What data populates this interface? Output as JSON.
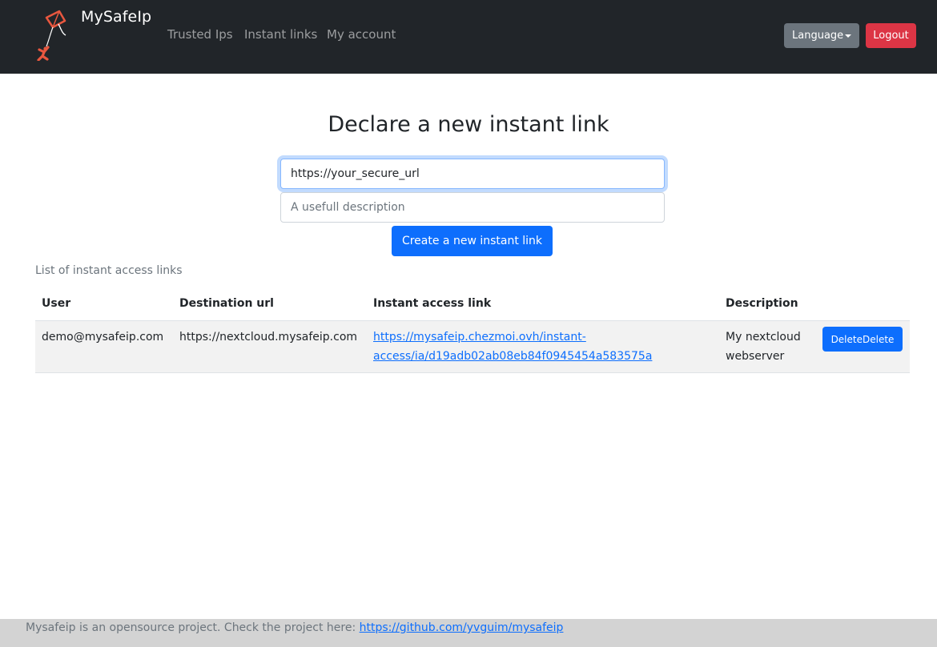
{
  "navbar": {
    "brand": "MySafeIp",
    "logo_icon": "kite-person-icon",
    "links": [
      "Trusted Ips",
      "Instant links",
      "My account"
    ],
    "language_label": "Language",
    "logout_label": "Logout"
  },
  "form": {
    "heading": "Declare a new instant link",
    "url_value": "https://your_secure_url",
    "description_placeholder": "A usefull description",
    "submit_label": "Create a new instant link"
  },
  "list": {
    "title": "List of instant access links",
    "columns": [
      "User",
      "Destination url",
      "Instant access link",
      "Description"
    ],
    "rows": [
      {
        "user": "demo@mysafeip.com",
        "destination_url": "https://nextcloud.mysafeip.com",
        "instant_link_line1": "https://mysafeip.chezmoi.ovh/instant-",
        "instant_link_line2": "access/ia/d19adb02ab08eb84f0945454a583575a",
        "description_line1": "My nextcloud",
        "description_line2": "webserver",
        "delete_label": "DeleteDelete"
      }
    ]
  },
  "footer": {
    "text": "Mysafeip is an opensource project. Check the project here: ",
    "link": "https://github.com/yvguim/mysafeip"
  },
  "colors": {
    "navbar_bg": "#212529",
    "primary": "#0d6efd",
    "danger": "#dc3545",
    "secondary": "#6c757d",
    "footer_bg": "#d3d3d3"
  }
}
